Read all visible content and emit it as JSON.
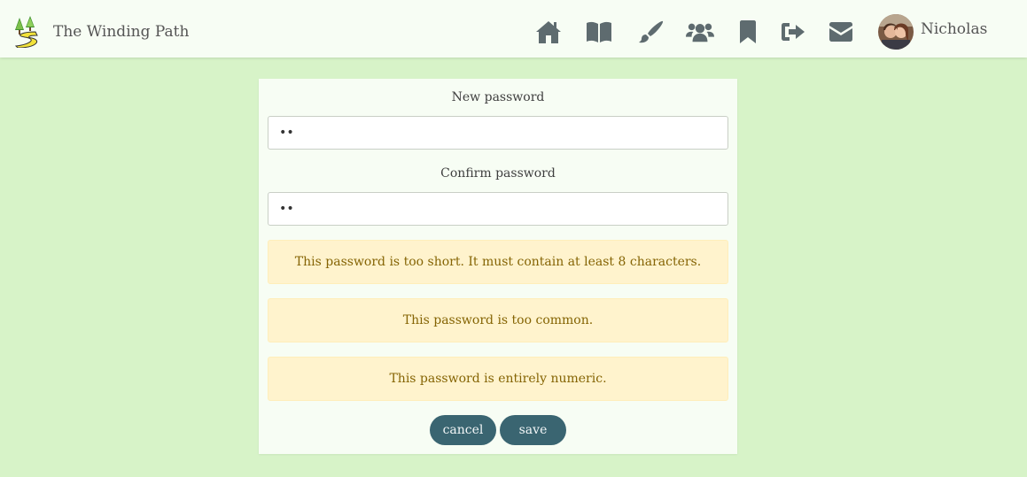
{
  "navbar": {
    "brand_name": "The Winding Path",
    "icons": [
      {
        "name": "home-icon"
      },
      {
        "name": "book-icon"
      },
      {
        "name": "paintbrush-icon"
      },
      {
        "name": "users-icon"
      },
      {
        "name": "bookmark-icon"
      },
      {
        "name": "sign-out-icon"
      },
      {
        "name": "envelope-icon"
      }
    ],
    "user": {
      "name": "Nicholas"
    }
  },
  "form": {
    "new_password": {
      "label": "New password",
      "value": "••"
    },
    "confirm_password": {
      "label": "Confirm password",
      "value": "••"
    },
    "errors": [
      "This password is too short. It must contain at least 8 characters.",
      "This password is too common.",
      "This password is entirely numeric."
    ],
    "cancel_label": "cancel",
    "save_label": "save"
  },
  "colors": {
    "page_background": "#d7f3c8",
    "navbar_background": "#f7fdf4",
    "button": "#3a6571",
    "alert_background": "#fff3cd",
    "alert_text": "#856404",
    "icon": "#5e6b6f"
  }
}
